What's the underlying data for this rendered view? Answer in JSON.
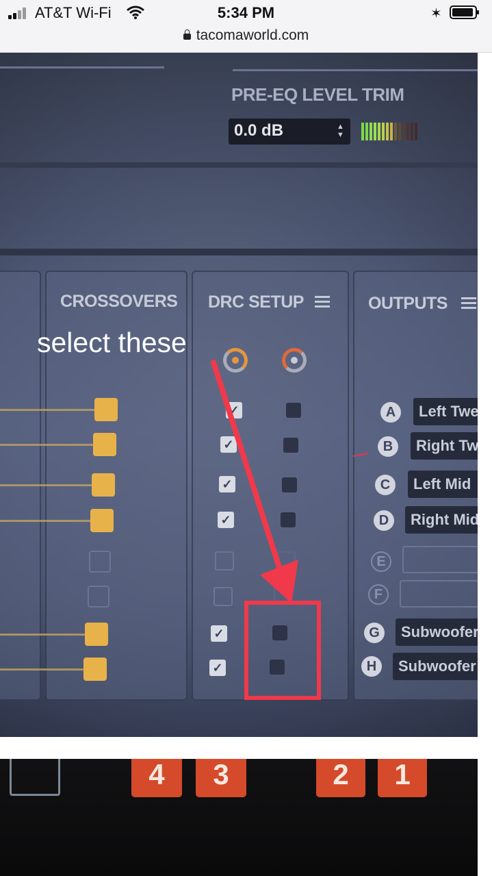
{
  "status_bar": {
    "carrier": "AT&T Wi-Fi",
    "time": "5:34 PM",
    "url": "tacomaworld.com"
  },
  "dsp_screen": {
    "pre_eq_label": "PRE-EQ LEVEL TRIM",
    "pre_eq_value": "0.0 dB",
    "columns": {
      "crossovers": "CROSSOVERS",
      "drc_setup": "DRC SETUP",
      "outputs": "OUTPUTS"
    },
    "drc_rows": [
      {
        "col1_checked": true,
        "col2_checked": false
      },
      {
        "col1_checked": true,
        "col2_checked": false
      },
      {
        "col1_checked": true,
        "col2_checked": false
      },
      {
        "col1_checked": true,
        "col2_checked": false
      },
      {
        "col1_checked": false,
        "col2_checked": false
      },
      {
        "col1_checked": false,
        "col2_checked": false
      },
      {
        "col1_checked": true,
        "col2_checked": false
      },
      {
        "col1_checked": true,
        "col2_checked": false
      }
    ],
    "outputs": [
      {
        "letter": "A",
        "name": "Left Twe"
      },
      {
        "letter": "B",
        "name": "Right Tw"
      },
      {
        "letter": "C",
        "name": "Left Mid"
      },
      {
        "letter": "D",
        "name": "Right Mid"
      },
      {
        "letter": "E",
        "name": ""
      },
      {
        "letter": "F",
        "name": ""
      },
      {
        "letter": "G",
        "name": "Subwoofer"
      },
      {
        "letter": "H",
        "name": "Subwoofer"
      }
    ]
  },
  "annotation": {
    "text": "select these",
    "color": "#f0394a"
  },
  "second_photo": {
    "keys": [
      "4",
      "3",
      "2",
      "1"
    ],
    "key_color": "#d44a2a"
  }
}
